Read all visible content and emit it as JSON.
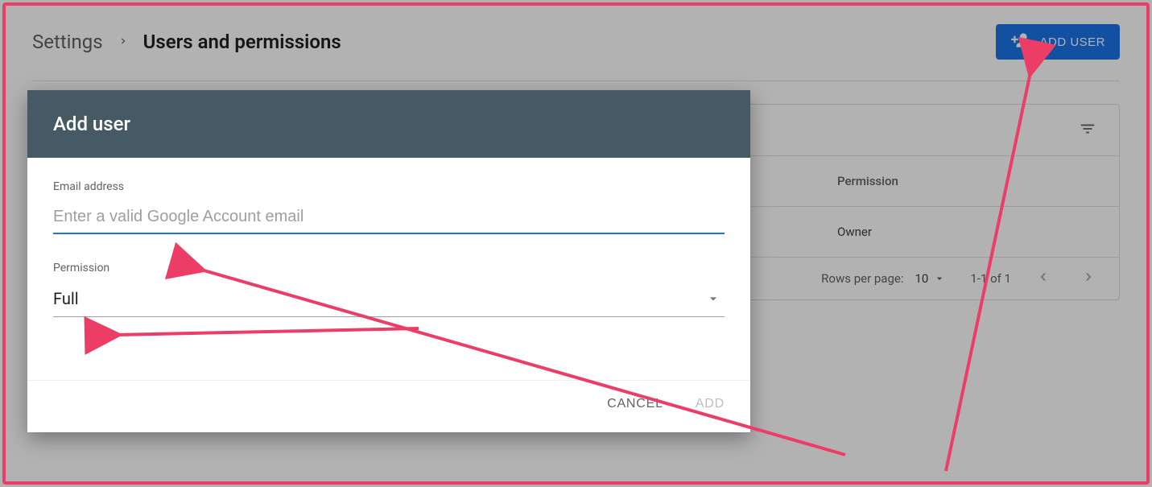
{
  "breadcrumb": {
    "parent": "Settings",
    "current": "Users and permissions"
  },
  "add_user_button": {
    "label": "ADD USER"
  },
  "table": {
    "columns": {
      "permission": "Permission"
    },
    "rows": [
      {
        "permission": "Owner"
      }
    ],
    "paginator": {
      "rows_per_page_label": "Rows per page:",
      "rows_per_page_value": "10",
      "range": "1-1 of 1"
    }
  },
  "dialog": {
    "title": "Add user",
    "email": {
      "label": "Email address",
      "placeholder": "Enter a valid Google Account email",
      "value": ""
    },
    "permission": {
      "label": "Permission",
      "value": "Full"
    },
    "actions": {
      "cancel": "CANCEL",
      "add": "ADD"
    }
  },
  "icons": {
    "add_person": "add-person-icon",
    "filter": "filter-icon",
    "chevron_left": "chevron-left-icon",
    "chevron_right": "chevron-right-icon",
    "dropdown": "dropdown-caret-icon"
  },
  "colors": {
    "primary": "#1a73e8",
    "dialog_header": "#455a64",
    "annotation": "#ec3d66"
  }
}
